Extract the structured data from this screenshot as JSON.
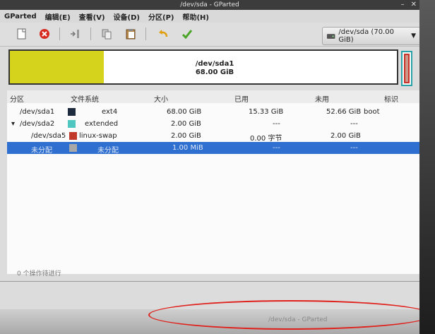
{
  "window": {
    "title": "/dev/sda - GParted"
  },
  "menu": [
    "GParted",
    "编辑(E)",
    "查看(V)",
    "设备(D)",
    "分区(P)",
    "帮助(H)"
  ],
  "toolbar": {
    "icons": [
      "new-partition-icon",
      "delete-icon",
      "resize-move-icon",
      "copy-icon",
      "paste-icon",
      "undo-icon",
      "apply-icon"
    ],
    "device_label": "/dev/sda (70.00 GiB)"
  },
  "diskmap": {
    "partition": "/dev/sda1",
    "size": "68.00 GiB",
    "used_fraction": 0.225
  },
  "table": {
    "headers": {
      "partition": "分区",
      "filesystem": "文件系统",
      "size": "大小",
      "used": "已用",
      "unused": "未用",
      "flags": "标识"
    },
    "rows": [
      {
        "partition": "/dev/sda1",
        "fs": "ext4",
        "color": "#1e2a3e",
        "size": "68.00 GiB",
        "used": "15.33 GiB",
        "unused": "52.66 GiB",
        "flags": "boot"
      },
      {
        "partition": "/dev/sda2",
        "fs": "extended",
        "color": "#4fc7c0",
        "size": "2.00 GiB",
        "used": "---",
        "unused": "---",
        "flags": ""
      },
      {
        "partition": "/dev/sda5",
        "fs": "linux-swap",
        "color": "#c0392b",
        "size": "2.00 GiB",
        "used": "0.00 字节",
        "unused": "2.00 GiB",
        "flags": ""
      },
      {
        "partition": "未分配",
        "fs": "未分配",
        "color": "#a8a8a8",
        "size": "1.00 MiB",
        "used": "---",
        "unused": "---",
        "flags": ""
      }
    ]
  },
  "status": {
    "pending": "0 个操作待进行"
  },
  "taskbar": {
    "item": "/dev/sda - GParted"
  },
  "colors": {
    "selection": "#2f6fcf",
    "used_yellow": "#d6d31c",
    "annotation_red": "#e0201a"
  }
}
